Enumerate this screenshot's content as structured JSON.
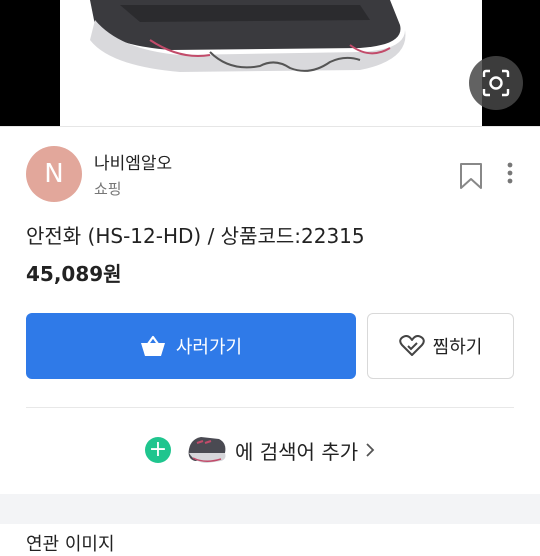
{
  "seller": {
    "avatar_letter": "N",
    "name": "나비엠알오",
    "category": "쇼핑"
  },
  "product": {
    "title": "안전화 (HS-12-HD) / 상품코드:22315",
    "price": "45,089원"
  },
  "actions": {
    "buy_label": "사러가기",
    "wish_label": "찜하기"
  },
  "search_add": {
    "label": "에 검색어 추가"
  },
  "bottom": {
    "peek_text": "연관 이미지"
  },
  "colors": {
    "primary": "#2f7ae8",
    "avatar": "#e2a79b",
    "plus": "#1fc58e"
  },
  "icons": [
    "image-search-icon",
    "bookmark-icon",
    "more-vertical-icon",
    "basket-icon",
    "heart-icon",
    "plus-icon",
    "chevron-right-icon"
  ]
}
